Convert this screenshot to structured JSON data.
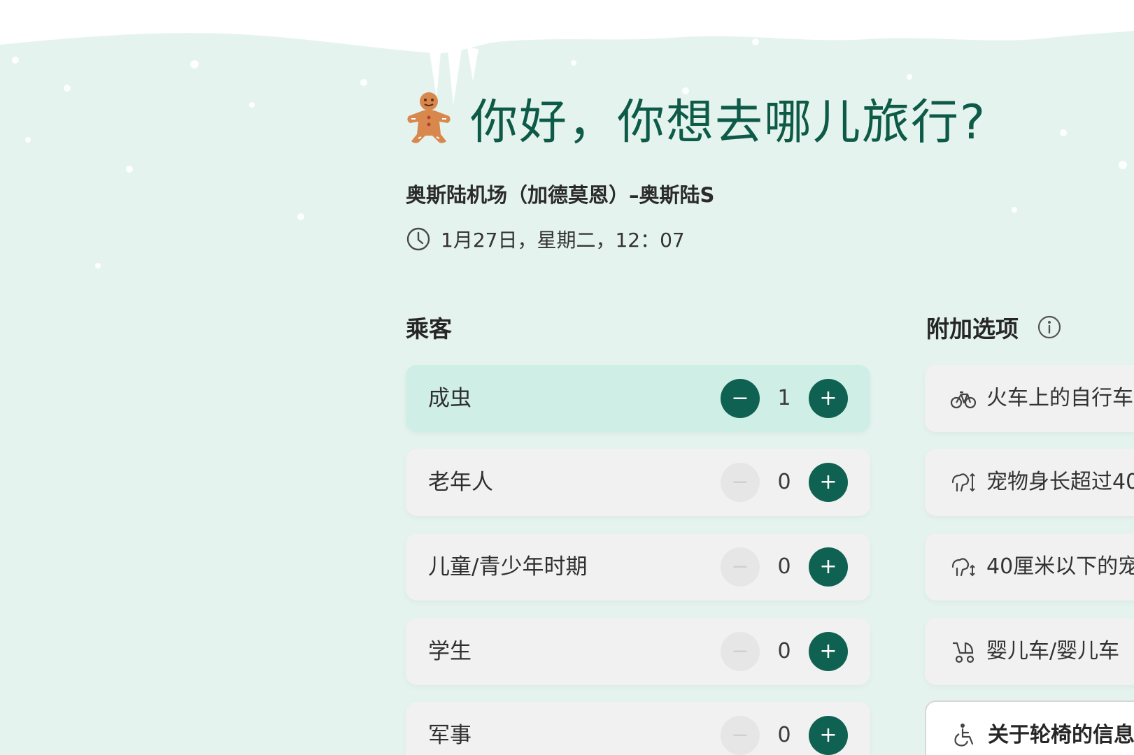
{
  "header": {
    "title": "你好，你想去哪儿旅行?",
    "title_icon": "gingerbread-man-icon"
  },
  "trip": {
    "route": "奥斯陆机场（加德莫恩）–奥斯陆S",
    "datetime": "1月27日，星期二，12：07",
    "datetime_icon": "clock-icon"
  },
  "passengers": {
    "title": "乘客",
    "items": [
      {
        "label": "成虫",
        "count": "1",
        "minus_enabled": true
      },
      {
        "label": "老年人",
        "count": "0",
        "minus_enabled": false
      },
      {
        "label": "儿童/青少年时期",
        "count": "0",
        "minus_enabled": false
      },
      {
        "label": "学生",
        "count": "0",
        "minus_enabled": false
      },
      {
        "label": "军事",
        "count": "0",
        "minus_enabled": false
      }
    ],
    "minus_symbol": "−",
    "plus_symbol": "+"
  },
  "extras": {
    "title": "附加选项",
    "info_icon": "info-icon",
    "items": [
      {
        "label": "火车上的自行车",
        "icon": "bicycle-icon"
      },
      {
        "label": "宠物身长超过40",
        "icon": "pet-large-icon"
      },
      {
        "label": "40厘米以下的宠",
        "icon": "pet-small-icon"
      },
      {
        "label": "婴儿车/婴儿车",
        "icon": "stroller-icon"
      },
      {
        "label": "关于轮椅的信息",
        "icon": "wheelchair-icon"
      }
    ]
  },
  "colors": {
    "brand_green": "#0f6252",
    "title_green": "#0d5a47",
    "mint_background": "#e5f3ef",
    "active_row": "#cfeee6"
  }
}
